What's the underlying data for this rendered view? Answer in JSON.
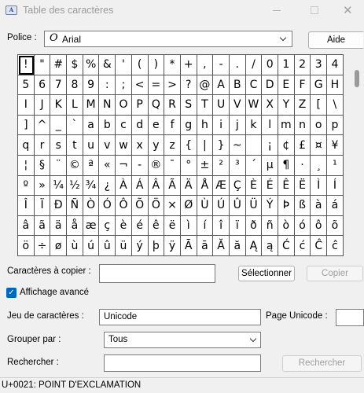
{
  "window": {
    "title": "Table des caractères",
    "app_icon_text": "A"
  },
  "font_label": "Police :",
  "font_value": "Arial",
  "font_glyph": "O",
  "help_button": "Aide",
  "characters": [
    "!",
    "\"",
    "#",
    "$",
    "%",
    "&",
    "'",
    "(",
    ")",
    "*",
    "+",
    ",",
    "-",
    ".",
    "/",
    "0",
    "1",
    "2",
    "3",
    "4",
    "5",
    "6",
    "7",
    "8",
    "9",
    ":",
    ";",
    "<",
    "=",
    ">",
    "?",
    "@",
    "A",
    "B",
    "C",
    "D",
    "E",
    "F",
    "G",
    "H",
    "I",
    "J",
    "K",
    "L",
    "M",
    "N",
    "O",
    "P",
    "Q",
    "R",
    "S",
    "T",
    "U",
    "V",
    "W",
    "X",
    "Y",
    "Z",
    "[",
    "\\",
    "]",
    "^",
    "_",
    "`",
    "a",
    "b",
    "c",
    "d",
    "e",
    "f",
    "g",
    "h",
    "i",
    "j",
    "k",
    "l",
    "m",
    "n",
    "o",
    "p",
    "q",
    "r",
    "s",
    "t",
    "u",
    "v",
    "w",
    "x",
    "y",
    "z",
    "{",
    "|",
    "}",
    "~",
    " ",
    "¡",
    "¢",
    "£",
    "¤",
    "¥",
    "¦",
    "§",
    "¨",
    "©",
    "ª",
    "«",
    "¬",
    "-",
    "®",
    "¯",
    "°",
    "±",
    "²",
    "³",
    "´",
    "µ",
    "¶",
    "·",
    "¸",
    "¹",
    "º",
    "»",
    "¼",
    "½",
    "¾",
    "¿",
    "À",
    "Á",
    "Â",
    "Ã",
    "Ä",
    "Å",
    "Æ",
    "Ç",
    "È",
    "É",
    "Ê",
    "Ë",
    "Ì",
    "Í",
    "Î",
    "Ï",
    "Ð",
    "Ñ",
    "Ò",
    "Ó",
    "Ô",
    "Õ",
    "Ö",
    "×",
    "Ø",
    "Ù",
    "Ú",
    "Û",
    "Ü",
    "Ý",
    "Þ",
    "ß",
    "à",
    "á",
    "â",
    "ã",
    "ä",
    "å",
    "æ",
    "ç",
    "è",
    "é",
    "ê",
    "ë",
    "ì",
    "í",
    "î",
    "ï",
    "ð",
    "ñ",
    "ò",
    "ó",
    "ô",
    "õ",
    "ö",
    "÷",
    "ø",
    "ù",
    "ú",
    "û",
    "ü",
    "ý",
    "þ",
    "ÿ",
    "Ā",
    "ā",
    "Ă",
    "ă",
    "Ą",
    "ą",
    "Ć",
    "ć",
    "Ĉ",
    "ĉ"
  ],
  "selected_index": 0,
  "copy": {
    "label": "Caractères à copier :",
    "value": "",
    "select_button": "Sélectionner",
    "copy_button": "Copier"
  },
  "advanced_view": {
    "label": "Affichage avancé",
    "checked": true
  },
  "charset": {
    "label": "Jeu de caractères :",
    "value": "Unicode"
  },
  "unicode_page": {
    "label": "Page Unicode :",
    "value": ""
  },
  "group_by": {
    "label": "Grouper par :",
    "value": "Tous"
  },
  "search": {
    "label": "Rechercher :",
    "value": "",
    "button": "Rechercher"
  },
  "status": "U+0021: POINT D'EXCLAMATION"
}
